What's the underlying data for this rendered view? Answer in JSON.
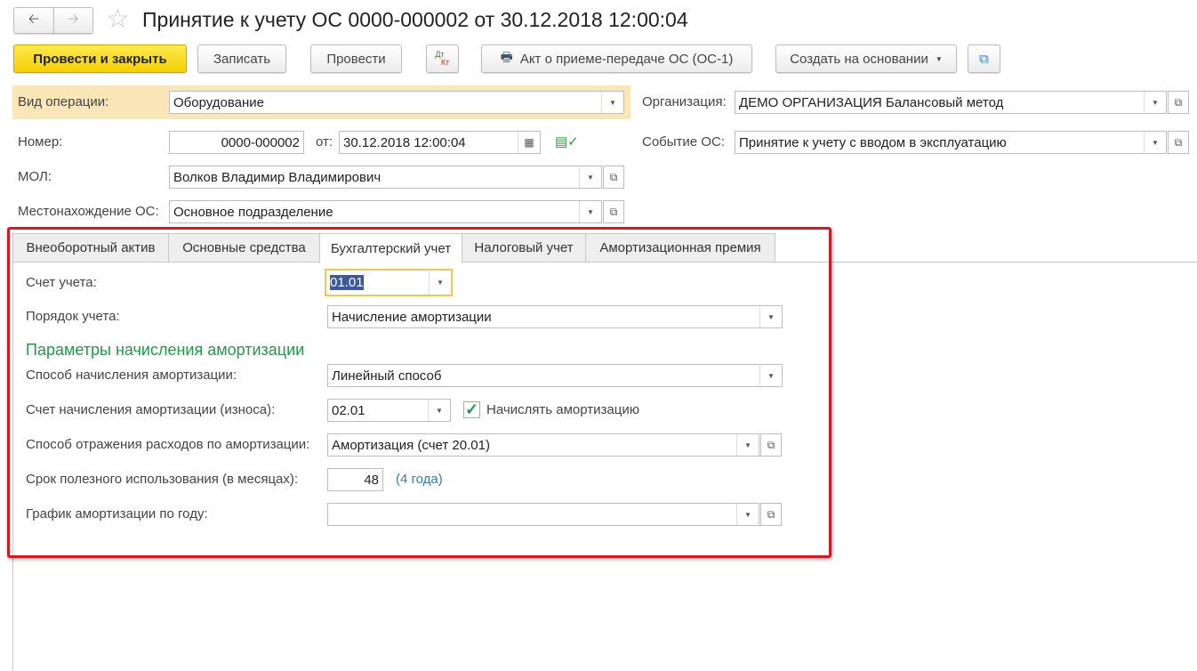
{
  "header": {
    "title": "Принятие к учету ОС 0000-000002 от 30.12.2018 12:00:04"
  },
  "toolbar": {
    "post_close": "Провести и закрыть",
    "save": "Записать",
    "post": "Провести",
    "dt": "Дт",
    "kt": "Кт",
    "print_act": "Акт о приеме-передаче ОС (ОС-1)",
    "create_based": "Создать на основании"
  },
  "form": {
    "op_type_label": "Вид операции:",
    "op_type": "Оборудование",
    "org_label": "Организация:",
    "org": "ДЕМО ОРГАНИЗАЦИЯ Балансовый метод",
    "number_label": "Номер:",
    "number": "0000-000002",
    "date_label": "от:",
    "date": "30.12.2018 12:00:04",
    "event_label": "Событие ОС:",
    "event": "Принятие к учету с вводом в эксплуатацию",
    "mol_label": "МОЛ:",
    "mol": "Волков Владимир Владимирович",
    "location_label": "Местонахождение ОС:",
    "location": "Основное подразделение"
  },
  "tabs": [
    "Внеоборотный актив",
    "Основные средства",
    "Бухгалтерский учет",
    "Налоговый учет",
    "Амортизационная премия"
  ],
  "accounting": {
    "account_label": "Счет учета:",
    "account": "01.01",
    "order_label": "Порядок учета:",
    "order": "Начисление амортизации",
    "section_title": "Параметры начисления амортизации",
    "method_label": "Способ начисления амортизации:",
    "method": "Линейный способ",
    "dep_account_label": "Счет начисления амортизации (износа):",
    "dep_account": "02.01",
    "accrue_label": "Начислять амортизацию",
    "accrue_checked": true,
    "expense_label": "Способ отражения расходов по амортизации:",
    "expense": "Амортизация (счет 20.01)",
    "life_label": "Срок полезного использования (в месяцах):",
    "life": "48",
    "life_hint": "(4 года)",
    "schedule_label": "График амортизации по году:",
    "schedule": ""
  }
}
